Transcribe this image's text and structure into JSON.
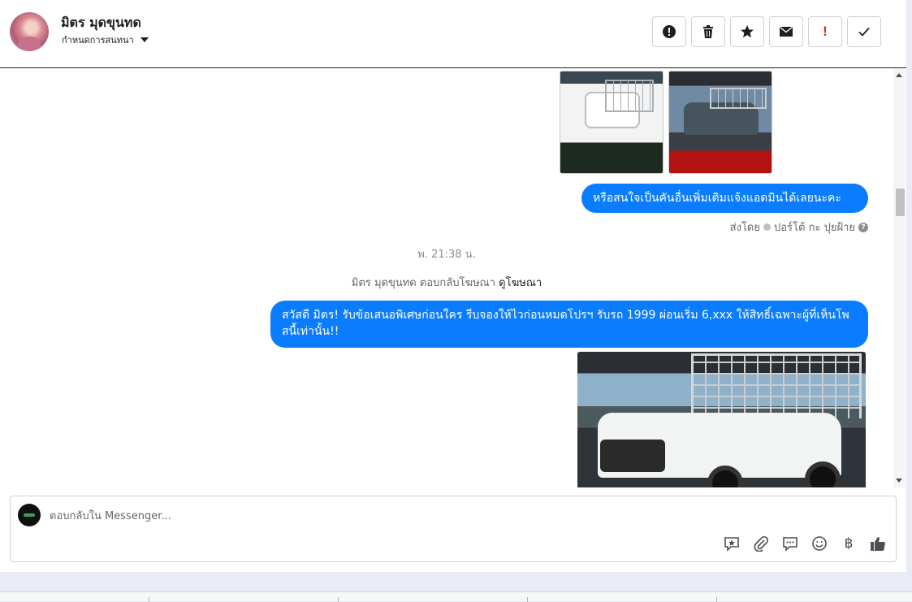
{
  "header": {
    "contact_name": "มิตร มุดขุนทด",
    "label_select": "กำหนดการสนทนา",
    "actions": [
      {
        "icon": "alert-icon",
        "label": "mark-spam"
      },
      {
        "icon": "trash-icon",
        "label": "delete"
      },
      {
        "icon": "star-icon",
        "label": "star"
      },
      {
        "icon": "envelope-icon",
        "label": "mark-unread"
      },
      {
        "icon": "exclamation-icon",
        "label": "follow-up",
        "text": "!"
      },
      {
        "icon": "check-icon",
        "label": "done"
      }
    ]
  },
  "conversation": {
    "message1": "หรือสนใจเป็นคันอื่นเพิ่มเติมแจ้งแอดมินได้เลยนะคะ",
    "sent_by_prefix": "ส่งโดย",
    "sent_by_name": "ปอร์โต้ กะ ปุยฝ้าย",
    "help_mark": "?",
    "timestamp": "พ. 21:38 น.",
    "reply_note_text": "มิตร มุดขุนทด ตอบกลับโฆษณา",
    "reply_note_link": "ดูโฆษณา",
    "message2": "สวัสดี มิตร! รับข้อเสนอพิเศษก่อนใคร รีบจองให้ไวก่อนหมดโปรฯ รับรถ 1999 ผ่อนเริ่ม 6,xxx ให้สิทธิ์เฉพาะผู้ที่เห็นโพสนี้เท่านั้น!!"
  },
  "composer": {
    "placeholder": "ตอบกลับใน Messenger...",
    "tools": [
      "saved-reply-icon",
      "attachment-icon",
      "chat-icon",
      "emoji-icon",
      "baht-icon",
      "like-icon"
    ],
    "baht_symbol": "฿"
  },
  "colors": {
    "bubble": "#0a7cff",
    "accent_red": "#e0321b"
  }
}
